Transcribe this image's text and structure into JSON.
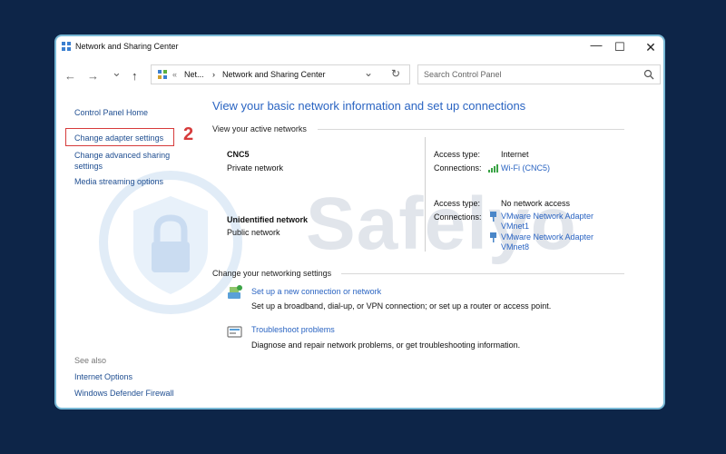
{
  "window": {
    "title": "Network and Sharing Center",
    "minimize_glyph": "—",
    "maximize_glyph": "☐",
    "close_glyph": "✕"
  },
  "nav": {
    "back_glyph": "←",
    "forward_glyph": "→",
    "dropdown_glyph": "⌄",
    "up_glyph": "↑"
  },
  "address": {
    "prefix": "«",
    "segment_1": "Net...",
    "separator": "›",
    "segment_2": "Network and Sharing Center",
    "dropdown_glyph": "⌄",
    "refresh_glyph": "↻"
  },
  "search": {
    "placeholder": "Search Control Panel"
  },
  "sidebar": {
    "home": "Control Panel Home",
    "change_adapter": "Change adapter settings",
    "advanced_sharing_1": "Change advanced sharing",
    "advanced_sharing_2": "settings",
    "media_streaming": "Media streaming options",
    "see_also": "See also",
    "internet_options": "Internet Options",
    "firewall": "Windows Defender Firewall"
  },
  "annotation": {
    "step": "2"
  },
  "main": {
    "title": "View your basic network information and set up connections",
    "active_networks_label": "View your active networks",
    "networks": [
      {
        "name": "CNC5",
        "type": "Private network",
        "access_label": "Access type:",
        "access_value": "Internet",
        "connections_label": "Connections:",
        "connection_1": "Wi-Fi (CNC5)"
      },
      {
        "name": "Unidentified network",
        "type": "Public network",
        "access_label": "Access type:",
        "access_value": "No network access",
        "connections_label": "Connections:",
        "connection_1a": "VMware Network Adapter",
        "connection_1b": "VMnet1",
        "connection_2a": "VMware Network Adapter",
        "connection_2b": "VMnet8"
      }
    ],
    "change_settings_label": "Change your networking settings",
    "tasks": [
      {
        "title": "Set up a new connection or network",
        "desc": "Set up a broadband, dial-up, or VPN connection; or set up a router or access point."
      },
      {
        "title": "Troubleshoot problems",
        "desc": "Diagnose and repair network problems, or get troubleshooting information."
      }
    ]
  },
  "watermark": {
    "text": "Safelyo"
  },
  "colors": {
    "background": "#0d2548",
    "window_border": "#79b9d6",
    "link": "#2a64c2",
    "highlight": "#d63b3b"
  }
}
